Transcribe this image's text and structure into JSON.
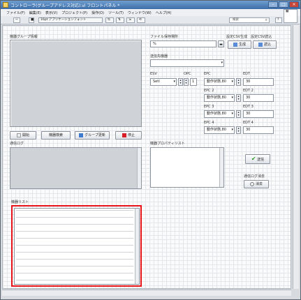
{
  "window": {
    "title": "コントローラ(グループアドレス対応).vi フロントパネル *"
  },
  "menu": [
    "ファイル(F)",
    "編集(E)",
    "表示(V)",
    "プロジェクト(P)",
    "操作(O)",
    "ツール(T)",
    "ウィンドウ(W)",
    "ヘルプ(H)"
  ],
  "toolbar": {
    "font": "16pt アプリケーションフォント",
    "search_placeholder": "検索"
  },
  "group_panel": {
    "label": "機器グループ情報"
  },
  "file_path": {
    "label": "ファイル保存場所",
    "value": "%"
  },
  "csv": {
    "label": "設定CSV生成　設定CSV読込",
    "create": "生成",
    "read": "読込"
  },
  "target_device": {
    "label": "送信先機器"
  },
  "table_headers": {
    "ESV": "ESV",
    "OPC": "OPC",
    "EPC": "EPC",
    "EDT": "EDT"
  },
  "esv_value": "SetI",
  "opc_value": "1",
  "epc": [
    {
      "label": "EPC",
      "value": "動作状態,80",
      "edt_label": "EDT",
      "edt": "30"
    },
    {
      "label": "EPC 2",
      "value": "動作状態,80",
      "edt_label": "EDT 2",
      "edt": "30"
    },
    {
      "label": "EPC 3",
      "value": "動作状態,80",
      "edt_label": "EDT 3",
      "edt": "30"
    },
    {
      "label": "EPC 4",
      "value": "動作状態,80",
      "edt_label": "EDT 4",
      "edt": "30"
    }
  ],
  "buttons": {
    "open": "開始",
    "search": "機器検索",
    "group_update": "グループ更新",
    "stop": "停止",
    "send": "送信",
    "clear": "消去"
  },
  "labels": {
    "comm_log": "通信ログ",
    "prop_list": "機器プロパティリスト",
    "recv_chk": "通信ログ消去",
    "device_list": "機器リスト"
  },
  "colors": {
    "highlight": "#e6131a",
    "accent": "#3c6da8"
  }
}
